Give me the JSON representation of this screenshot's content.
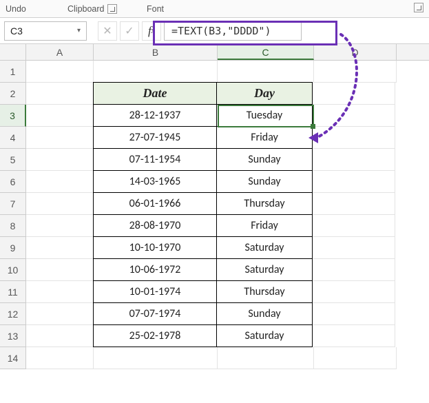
{
  "ribbon": {
    "undo_label": "Undo",
    "clipboard_label": "Clipboard",
    "font_label": "Font"
  },
  "formula_bar": {
    "name_box": "C3",
    "formula": "=TEXT(B3,\"DDDD\")"
  },
  "columns": [
    "A",
    "B",
    "C",
    "D"
  ],
  "row_numbers": [
    "1",
    "2",
    "3",
    "4",
    "5",
    "6",
    "7",
    "8",
    "9",
    "10",
    "11",
    "12",
    "13",
    "14"
  ],
  "table": {
    "headers": {
      "date": "Date",
      "day": "Day"
    },
    "rows": [
      {
        "date": "28-12-1937",
        "day": "Tuesday"
      },
      {
        "date": "27-07-1945",
        "day": "Friday"
      },
      {
        "date": "07-11-1954",
        "day": "Sunday"
      },
      {
        "date": "14-03-1965",
        "day": "Sunday"
      },
      {
        "date": "06-01-1966",
        "day": "Thursday"
      },
      {
        "date": "28-08-1970",
        "day": "Friday"
      },
      {
        "date": "10-10-1970",
        "day": "Saturday"
      },
      {
        "date": "10-06-1972",
        "day": "Saturday"
      },
      {
        "date": "10-01-1974",
        "day": "Thursday"
      },
      {
        "date": "07-07-1974",
        "day": "Sunday"
      },
      {
        "date": "25-02-1978",
        "day": "Saturday"
      }
    ]
  },
  "active_cell": "C3",
  "selected_column": "C",
  "selected_row": "3"
}
